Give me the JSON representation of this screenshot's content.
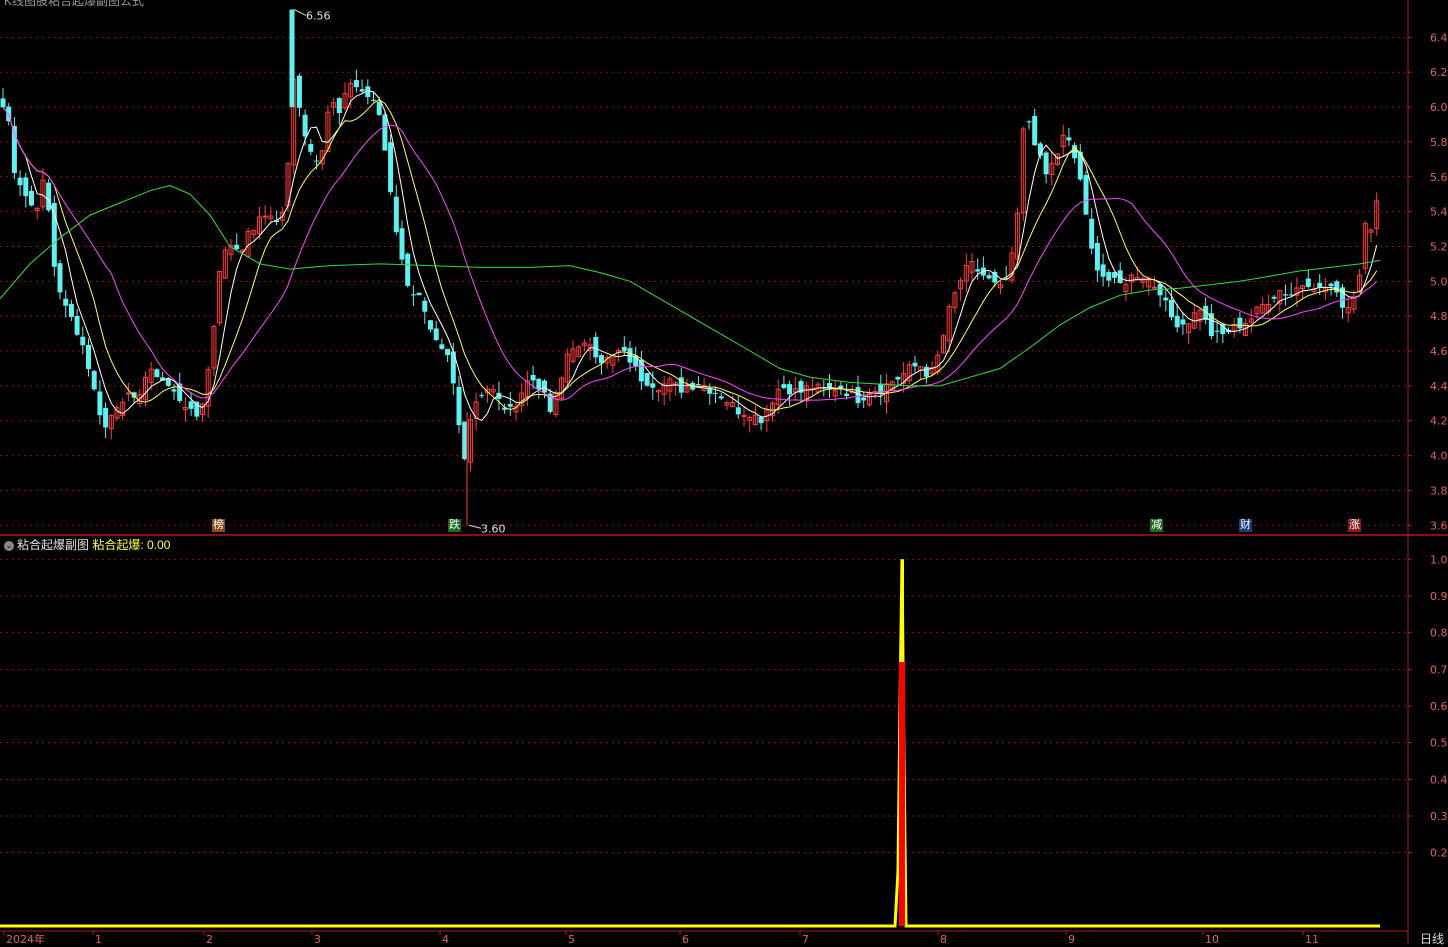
{
  "header": {
    "title": "K线图股粘合起爆副图公式"
  },
  "sub_panel": {
    "name": "粘合起爆副图",
    "indicator_label": "粘合起爆:",
    "indicator_value": "0.00"
  },
  "period_label": "日线",
  "colors": {
    "up": "#ff3b3b",
    "down": "#5ff0f0",
    "ma5": "#ffffff",
    "ma10": "#ffff55",
    "ma20": "#ff44ff",
    "ma60": "#33dd33",
    "grid": "#8a1010",
    "signal_yellow": "#ffff00",
    "signal_red": "#ff0000"
  },
  "chart_data": [
    {
      "type": "candlestick",
      "y_ticks": [
        "6.40",
        "6.20",
        "6.00",
        "5.80",
        "5.60",
        "5.40",
        "5.20",
        "5.00",
        "4.80",
        "4.60",
        "4.40",
        "4.20",
        "4.00",
        "3.80",
        "3.60"
      ],
      "ylim": [
        3.55,
        6.58
      ],
      "x_ticks": [
        "2024年",
        "1",
        "2",
        "3",
        "4",
        "5",
        "6",
        "7",
        "8",
        "9",
        "10",
        "11"
      ],
      "max_label": "6.56",
      "min_label": "3.60",
      "annotations": [
        {
          "label": "榜",
          "bg": "#8a4d1a"
        },
        {
          "label": "跌",
          "bg": "#1a6a1a"
        },
        {
          "label": "减",
          "bg": "#1a6a1a"
        },
        {
          "label": "财",
          "bg": "#1a3a7a"
        },
        {
          "label": "涨",
          "bg": "#8a1a1a"
        }
      ],
      "close_path": [
        [
          0,
          5.95
        ],
        [
          6,
          6.05
        ],
        [
          14,
          5.65
        ],
        [
          25,
          5.5
        ],
        [
          35,
          5.4
        ],
        [
          45,
          5.6
        ],
        [
          55,
          5.05
        ],
        [
          65,
          4.85
        ],
        [
          75,
          4.75
        ],
        [
          85,
          4.6
        ],
        [
          95,
          4.35
        ],
        [
          105,
          4.15
        ],
        [
          115,
          4.28
        ],
        [
          125,
          4.35
        ],
        [
          135,
          4.3
        ],
        [
          145,
          4.45
        ],
        [
          155,
          4.48
        ],
        [
          165,
          4.42
        ],
        [
          175,
          4.35
        ],
        [
          185,
          4.3
        ],
        [
          195,
          4.2
        ],
        [
          205,
          4.35
        ],
        [
          213,
          4.7
        ],
        [
          220,
          5.1
        ],
        [
          230,
          5.22
        ],
        [
          240,
          5.18
        ],
        [
          250,
          5.28
        ],
        [
          260,
          5.35
        ],
        [
          270,
          5.4
        ],
        [
          280,
          5.3
        ],
        [
          290,
          5.75
        ],
        [
          296,
          6.4
        ],
        [
          300,
          5.95
        ],
        [
          310,
          5.75
        ],
        [
          320,
          5.7
        ],
        [
          330,
          6.05
        ],
        [
          340,
          5.95
        ],
        [
          350,
          6.15
        ],
        [
          360,
          6.1
        ],
        [
          370,
          6.05
        ],
        [
          380,
          5.95
        ],
        [
          390,
          5.55
        ],
        [
          400,
          5.15
        ],
        [
          410,
          4.95
        ],
        [
          420,
          4.9
        ],
        [
          430,
          4.7
        ],
        [
          440,
          4.6
        ],
        [
          450,
          4.55
        ],
        [
          458,
          4.2
        ],
        [
          465,
          4.0
        ],
        [
          472,
          4.28
        ],
        [
          480,
          4.35
        ],
        [
          490,
          4.4
        ],
        [
          500,
          4.3
        ],
        [
          510,
          4.25
        ],
        [
          520,
          4.35
        ],
        [
          530,
          4.45
        ],
        [
          540,
          4.4
        ],
        [
          550,
          4.25
        ],
        [
          560,
          4.4
        ],
        [
          570,
          4.65
        ],
        [
          580,
          4.6
        ],
        [
          590,
          4.65
        ],
        [
          600,
          4.55
        ],
        [
          610,
          4.55
        ],
        [
          620,
          4.6
        ],
        [
          630,
          4.55
        ],
        [
          640,
          4.45
        ],
        [
          650,
          4.42
        ],
        [
          660,
          4.4
        ],
        [
          670,
          4.42
        ],
        [
          680,
          4.38
        ],
        [
          690,
          4.4
        ],
        [
          700,
          4.42
        ],
        [
          710,
          4.38
        ],
        [
          720,
          4.35
        ],
        [
          730,
          4.3
        ],
        [
          740,
          4.25
        ],
        [
          750,
          4.25
        ],
        [
          760,
          4.2
        ],
        [
          770,
          4.3
        ],
        [
          780,
          4.4
        ],
        [
          790,
          4.38
        ],
        [
          800,
          4.36
        ],
        [
          810,
          4.4
        ],
        [
          820,
          4.38
        ],
        [
          830,
          4.37
        ],
        [
          840,
          4.4
        ],
        [
          850,
          4.35
        ],
        [
          860,
          4.32
        ],
        [
          870,
          4.38
        ],
        [
          880,
          4.38
        ],
        [
          890,
          4.42
        ],
        [
          900,
          4.45
        ],
        [
          910,
          4.5
        ],
        [
          920,
          4.52
        ],
        [
          930,
          4.45
        ],
        [
          940,
          4.6
        ],
        [
          950,
          4.85
        ],
        [
          960,
          5.0
        ],
        [
          970,
          5.1
        ],
        [
          980,
          5.05
        ],
        [
          990,
          5.0
        ],
        [
          1000,
          4.95
        ],
        [
          1010,
          5.05
        ],
        [
          1018,
          5.4
        ],
        [
          1025,
          6.0
        ],
        [
          1035,
          5.8
        ],
        [
          1045,
          5.6
        ],
        [
          1055,
          5.7
        ],
        [
          1065,
          5.85
        ],
        [
          1075,
          5.7
        ],
        [
          1080,
          5.6
        ],
        [
          1090,
          5.2
        ],
        [
          1100,
          5.05
        ],
        [
          1110,
          5.0
        ],
        [
          1120,
          4.98
        ],
        [
          1130,
          5.02
        ],
        [
          1140,
          5.05
        ],
        [
          1150,
          5.0
        ],
        [
          1160,
          4.95
        ],
        [
          1170,
          4.8
        ],
        [
          1180,
          4.75
        ],
        [
          1190,
          4.78
        ],
        [
          1200,
          4.85
        ],
        [
          1210,
          4.7
        ],
        [
          1220,
          4.68
        ],
        [
          1230,
          4.72
        ],
        [
          1240,
          4.75
        ],
        [
          1250,
          4.78
        ],
        [
          1260,
          4.85
        ],
        [
          1270,
          4.9
        ],
        [
          1280,
          4.95
        ],
        [
          1290,
          4.92
        ],
        [
          1300,
          4.98
        ],
        [
          1310,
          5.0
        ],
        [
          1320,
          4.95
        ],
        [
          1330,
          4.98
        ],
        [
          1340,
          4.88
        ],
        [
          1350,
          4.85
        ],
        [
          1360,
          5.05
        ],
        [
          1366,
          5.4
        ],
        [
          1372,
          5.3
        ],
        [
          1380,
          5.55
        ]
      ],
      "ma60_path": [
        [
          0,
          4.9
        ],
        [
          30,
          5.1
        ],
        [
          60,
          5.25
        ],
        [
          90,
          5.38
        ],
        [
          120,
          5.45
        ],
        [
          150,
          5.52
        ],
        [
          170,
          5.55
        ],
        [
          190,
          5.5
        ],
        [
          210,
          5.38
        ],
        [
          230,
          5.2
        ],
        [
          260,
          5.1
        ],
        [
          290,
          5.07
        ],
        [
          330,
          5.09
        ],
        [
          380,
          5.1
        ],
        [
          430,
          5.09
        ],
        [
          480,
          5.08
        ],
        [
          530,
          5.08
        ],
        [
          570,
          5.09
        ],
        [
          600,
          5.05
        ],
        [
          630,
          5.0
        ],
        [
          660,
          4.9
        ],
        [
          690,
          4.8
        ],
        [
          720,
          4.7
        ],
        [
          750,
          4.6
        ],
        [
          780,
          4.5
        ],
        [
          810,
          4.45
        ],
        [
          850,
          4.42
        ],
        [
          880,
          4.41
        ],
        [
          910,
          4.4
        ],
        [
          940,
          4.4
        ],
        [
          970,
          4.45
        ],
        [
          1000,
          4.5
        ],
        [
          1030,
          4.62
        ],
        [
          1060,
          4.75
        ],
        [
          1090,
          4.85
        ],
        [
          1120,
          4.92
        ],
        [
          1150,
          4.95
        ],
        [
          1180,
          4.96
        ],
        [
          1210,
          4.98
        ],
        [
          1240,
          5.0
        ],
        [
          1270,
          5.03
        ],
        [
          1300,
          5.06
        ],
        [
          1330,
          5.08
        ],
        [
          1360,
          5.1
        ],
        [
          1380,
          5.12
        ]
      ]
    },
    {
      "type": "line",
      "y_ticks": [
        "1.00",
        "0.90",
        "0.80",
        "0.70",
        "0.60",
        "0.50",
        "0.40",
        "0.30",
        "0.20"
      ],
      "ylim": [
        0,
        1.02
      ],
      "series": [
        {
          "name": "粘合起爆",
          "values_path": [
            [
              0,
              0
            ],
            [
              895,
              0
            ],
            [
              898,
              0.15
            ],
            [
              900,
              0.6
            ],
            [
              902,
              1.0
            ],
            [
              904,
              0.45
            ],
            [
              906,
              0
            ],
            [
              1380,
              0
            ]
          ]
        }
      ]
    }
  ]
}
